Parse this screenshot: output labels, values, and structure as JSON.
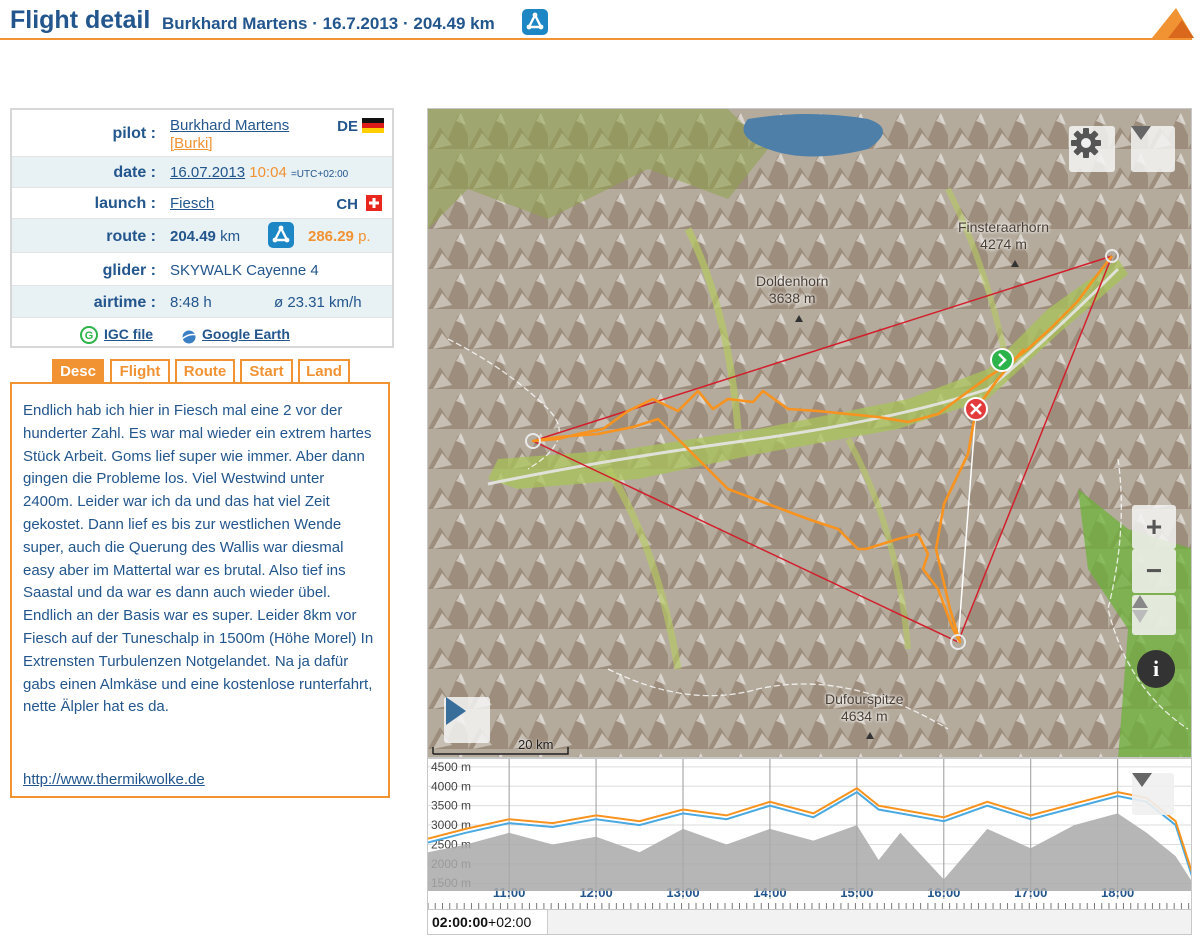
{
  "header": {
    "title": "Flight detail",
    "pilot": "Burkhard Martens",
    "date": "16.7.2013",
    "distance": "204.49 km",
    "sep": "·"
  },
  "info": {
    "pilot_label": "pilot :",
    "pilot_name": "Burkhard Martens",
    "pilot_nick": "[Burki]",
    "pilot_country": "DE",
    "date_label": "date :",
    "date_value": "16.07.2013",
    "time_value": "10:04",
    "tz_value": "=UTC+02:00",
    "launch_label": "launch :",
    "launch_value": "Fiesch",
    "launch_country": "CH",
    "route_label": "route :",
    "route_distance": "204.49",
    "route_km": "km",
    "route_points": "286.29",
    "route_points_unit": "p.",
    "glider_label": "glider :",
    "glider_value": "SKYWALK Cayenne 4",
    "airtime_label": "airtime :",
    "airtime_value": "8:48 h",
    "avg_speed": "ø 23.31 km/h",
    "igc_label": "IGC file",
    "ge_label": "Google Earth"
  },
  "tabs": [
    {
      "label": "Desc",
      "active": true
    },
    {
      "label": "Flight",
      "active": false
    },
    {
      "label": "Route",
      "active": false
    },
    {
      "label": "Start",
      "active": false
    },
    {
      "label": "Land",
      "active": false
    }
  ],
  "description": {
    "text": "Endlich hab ich hier in Fiesch mal eine 2 vor der hunderter Zahl. Es war mal wieder ein extrem hartes Stück Arbeit. Goms lief super wie immer. Aber dann gingen die Probleme los. Viel Westwind unter 2400m. Leider war ich da und das hat viel Zeit gekostet. Dann lief es bis zur westlichen Wende super, auch die Querung des Wallis war diesmal easy aber im Mattertal war es brutal. Also tief ins Saastal und da war es dann auch wieder übel. Endlich an der Basis war es super. Leider 8km vor Fiesch auf der Tuneschalp in 1500m (Höhe Morel) In Extrensten Turbulenzen Notgelandet. Na ja dafür gabs einen Almkäse und eine kostenlose runterfahrt, nette Älpler hat es da.",
    "url": "http://www.thermikwolke.de"
  },
  "map": {
    "peaks": [
      {
        "name": "Finsteraarhorn",
        "elev": "4274 m"
      },
      {
        "name": "Doldenhorn",
        "elev": "3638 m"
      },
      {
        "name": "Dufourspitze",
        "elev": "4634 m"
      }
    ],
    "scale_label": "20 km",
    "controls": [
      "gear-icon",
      "chevron-down-icon",
      "zoom-in",
      "zoom-out",
      "north-arrow",
      "info-icon",
      "play-icon"
    ],
    "zoom_in": "+",
    "zoom_out": "−",
    "info": "i",
    "colors": {
      "track": "#f7931e",
      "route": "#d21f2b",
      "start": "#2cb34a",
      "end": "#e33b3b"
    }
  },
  "chart_data": {
    "type": "area",
    "x_ticks": [
      "11:00",
      "12:00",
      "13:00",
      "14:00",
      "15:00",
      "16:00",
      "17:00",
      "18:00"
    ],
    "y_ticks": [
      "1500 m",
      "2000 m",
      "2500 m",
      "3000 m",
      "3500 m",
      "4000 m",
      "4500 m"
    ],
    "ylim": [
      1300,
      4600
    ],
    "xlim": [
      "10:04",
      "18:52"
    ],
    "series": [
      {
        "color": "#f7931e",
        "x": [
          "10:04",
          "10:30",
          "11:00",
          "11:30",
          "12:00",
          "12:30",
          "13:00",
          "13:30",
          "14:00",
          "14:30",
          "15:00",
          "15:15",
          "15:30",
          "16:00",
          "16:30",
          "17:00",
          "17:30",
          "18:00",
          "18:20",
          "18:40",
          "18:52"
        ],
        "y": [
          2650,
          2900,
          3150,
          3050,
          3250,
          3100,
          3400,
          3250,
          3600,
          3300,
          3950,
          3500,
          3400,
          3200,
          3600,
          3250,
          3550,
          3850,
          3700,
          3100,
          1700
        ]
      },
      {
        "color": "#4aa9e0",
        "x": [
          "10:04",
          "10:30",
          "11:00",
          "11:30",
          "12:00",
          "12:30",
          "13:00",
          "13:30",
          "14:00",
          "14:30",
          "15:00",
          "15:15",
          "15:30",
          "16:00",
          "16:30",
          "17:00",
          "17:30",
          "18:00",
          "18:20",
          "18:40",
          "18:52"
        ],
        "y": [
          2550,
          2800,
          3050,
          2950,
          3150,
          3000,
          3300,
          3150,
          3500,
          3200,
          3850,
          3400,
          3300,
          3100,
          3500,
          3150,
          3450,
          3750,
          3600,
          3000,
          1600
        ]
      }
    ],
    "terrain": {
      "x": [
        "10:04",
        "10:30",
        "11:00",
        "11:30",
        "12:00",
        "12:30",
        "13:00",
        "13:30",
        "14:00",
        "14:30",
        "15:00",
        "15:15",
        "15:30",
        "16:00",
        "16:30",
        "17:00",
        "17:30",
        "18:00",
        "18:20",
        "18:40",
        "18:52"
      ],
      "y": [
        2300,
        2500,
        2800,
        2500,
        2700,
        2300,
        2900,
        2500,
        2900,
        2600,
        3000,
        2100,
        2800,
        1600,
        2900,
        2400,
        3000,
        3300,
        2800,
        2200,
        1500
      ]
    }
  },
  "timebar": {
    "clock": "02:00:00",
    "tz": "+02:00"
  }
}
